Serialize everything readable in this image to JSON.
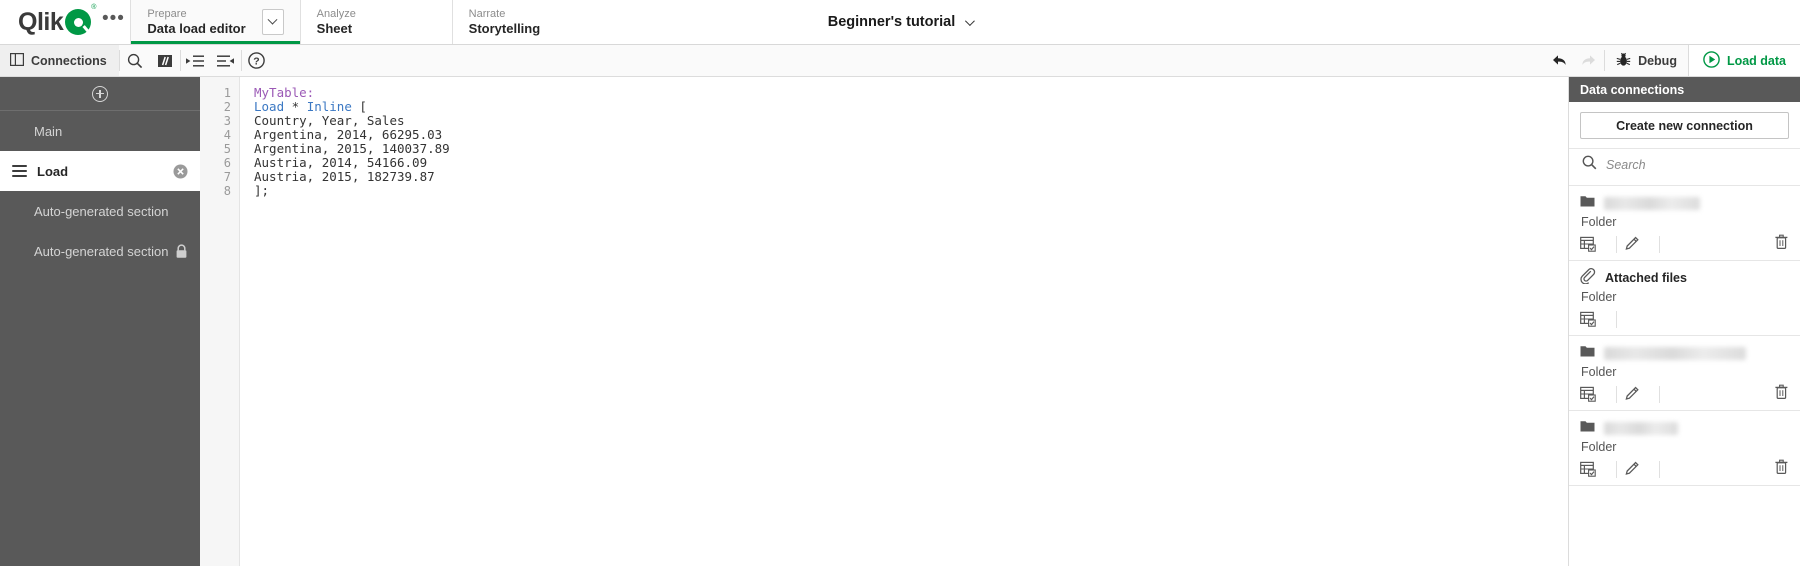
{
  "header": {
    "logo_text": "Qlik",
    "logo_icon": "qlik-logo-icon",
    "more_label": "•••",
    "nav": [
      {
        "kicker": "Prepare",
        "label": "Data load editor",
        "active": true,
        "caret": true
      },
      {
        "kicker": "Analyze",
        "label": "Sheet",
        "active": false,
        "caret": false
      },
      {
        "kicker": "Narrate",
        "label": "Storytelling",
        "active": false,
        "caret": false
      }
    ],
    "app_title": "Beginner's tutorial"
  },
  "toolbar": {
    "connections_label": "Connections",
    "search_icon": "search-icon",
    "comment_icon": "comment-toggle-icon",
    "indent_icon": "indent-icon",
    "outdent_icon": "outdent-icon",
    "help_icon": "help-icon",
    "undo_icon": "undo-icon",
    "redo_icon": "redo-icon",
    "debug_label": "Debug",
    "load_data_label": "Load data",
    "accent_green": "#009845"
  },
  "sidebar": {
    "add_section_icon": "add-section-icon",
    "items": [
      {
        "label": "Main",
        "active": false,
        "locked": false,
        "closable": false
      },
      {
        "label": "Load",
        "active": true,
        "locked": false,
        "closable": true
      },
      {
        "label": "Auto-generated section",
        "active": false,
        "locked": false,
        "closable": false
      },
      {
        "label": "Auto-generated section",
        "active": false,
        "locked": true,
        "closable": false
      }
    ]
  },
  "editor": {
    "line_numbers": [
      "1",
      "2",
      "3",
      "4",
      "5",
      "6",
      "7",
      "8"
    ],
    "lines": [
      [
        {
          "t": "MyTable:",
          "c": "tok-table"
        }
      ],
      [
        {
          "t": "Load",
          "c": "tok-kw"
        },
        {
          "t": " * ",
          "c": "tok-plain"
        },
        {
          "t": "Inline",
          "c": "tok-kw"
        },
        {
          "t": " [",
          "c": "tok-plain"
        }
      ],
      [
        {
          "t": "Country, Year, Sales",
          "c": "tok-plain"
        }
      ],
      [
        {
          "t": "Argentina, 2014, 66295.03",
          "c": "tok-plain"
        }
      ],
      [
        {
          "t": "Argentina, 2015, 140037.89",
          "c": "tok-plain"
        }
      ],
      [
        {
          "t": "Austria, 2014, 54166.09",
          "c": "tok-plain"
        }
      ],
      [
        {
          "t": "Austria, 2015, 182739.87",
          "c": "tok-plain"
        }
      ],
      [
        {
          "t": "];",
          "c": "tok-plain"
        }
      ]
    ]
  },
  "data_connections": {
    "title": "Data connections",
    "create_label": "Create new connection",
    "search_placeholder": "Search",
    "search_value": "",
    "items": [
      {
        "icon": "folder-icon",
        "name_redacted": true,
        "name_width": 96,
        "type": "Folder",
        "actions": [
          "select-data-icon",
          "edit-icon",
          "delete-icon"
        ]
      },
      {
        "icon": "paperclip-icon",
        "name_redacted": false,
        "name": "Attached files",
        "type": "Folder",
        "actions": [
          "select-data-icon"
        ]
      },
      {
        "icon": "folder-icon",
        "name_redacted": true,
        "name_width": 142,
        "type": "Folder",
        "actions": [
          "select-data-icon",
          "edit-icon",
          "delete-icon"
        ]
      },
      {
        "icon": "folder-icon",
        "name_redacted": true,
        "name_width": 74,
        "type": "Folder",
        "actions": [
          "select-data-icon",
          "edit-icon",
          "delete-icon"
        ]
      }
    ]
  }
}
